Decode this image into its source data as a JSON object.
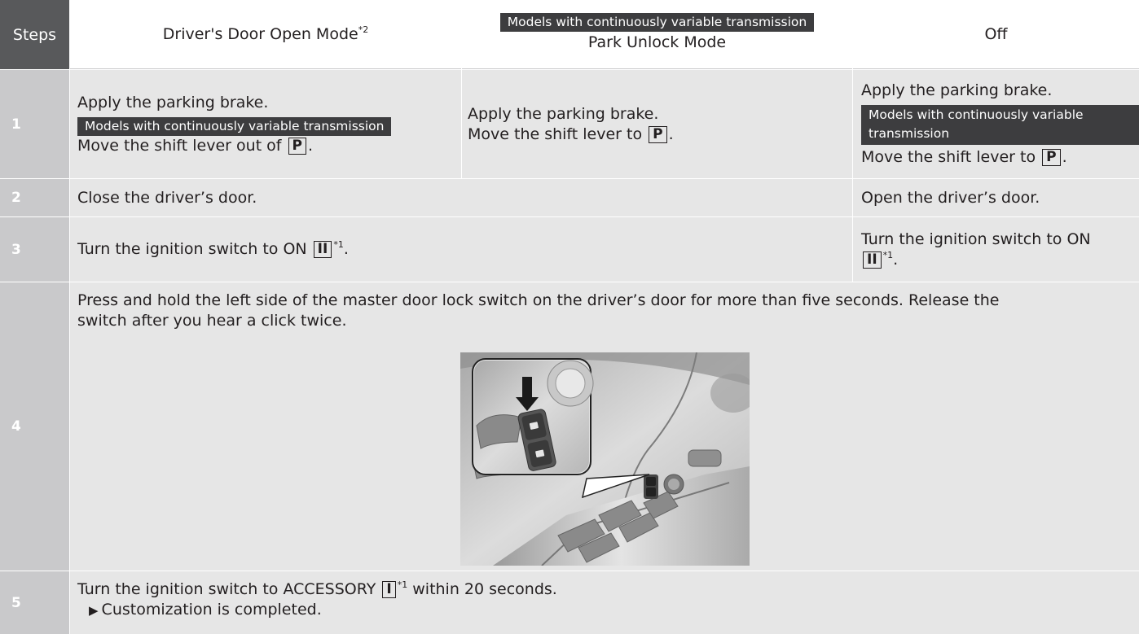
{
  "header": {
    "steps": "Steps",
    "col1_title": "Driver's Door Open Mode",
    "col1_sup": "*2",
    "col2_tag": "Models with continuously variable transmission",
    "col2_title": "Park Unlock Mode",
    "col3_title": "Off"
  },
  "rows": [
    {
      "num": "1",
      "col1_line1": "Apply the parking brake.",
      "col1_tag": "Models with continuously variable transmission",
      "col1_line2": "Move the shift lever out of",
      "col1_key": "P",
      "col1_end": ".",
      "col2_line1": "Apply the parking brake.",
      "col2_line2": "Move the shift lever to",
      "col2_key": "P",
      "col2_end": ".",
      "col3_line1": "Apply the parking brake.",
      "col3_tag": "Models with continuously variable transmission",
      "col3_line2": "Move the shift lever to",
      "col3_key": "P",
      "col3_end": "."
    },
    {
      "num": "2",
      "main": "Close the driver’s door.",
      "col3": "Open the driver’s door."
    },
    {
      "num": "3",
      "main_text": "Turn the ignition switch to ON",
      "main_key": "II",
      "main_sup": "*1",
      "main_end": ".",
      "col3_text": "Turn the ignition switch to ON",
      "col3_key": "II",
      "col3_sup": "*1",
      "col3_end": "."
    },
    {
      "num": "4",
      "text": "Press and hold the left side of the master door lock switch on the driver’s door for more than five seconds. Release the switch after you hear a click twice."
    },
    {
      "num": "5",
      "text1": "Turn the ignition switch to ACCESSORY",
      "key": "I",
      "sup": "*1",
      "text2": "within 20 seconds.",
      "sub": "Customization is completed."
    }
  ]
}
